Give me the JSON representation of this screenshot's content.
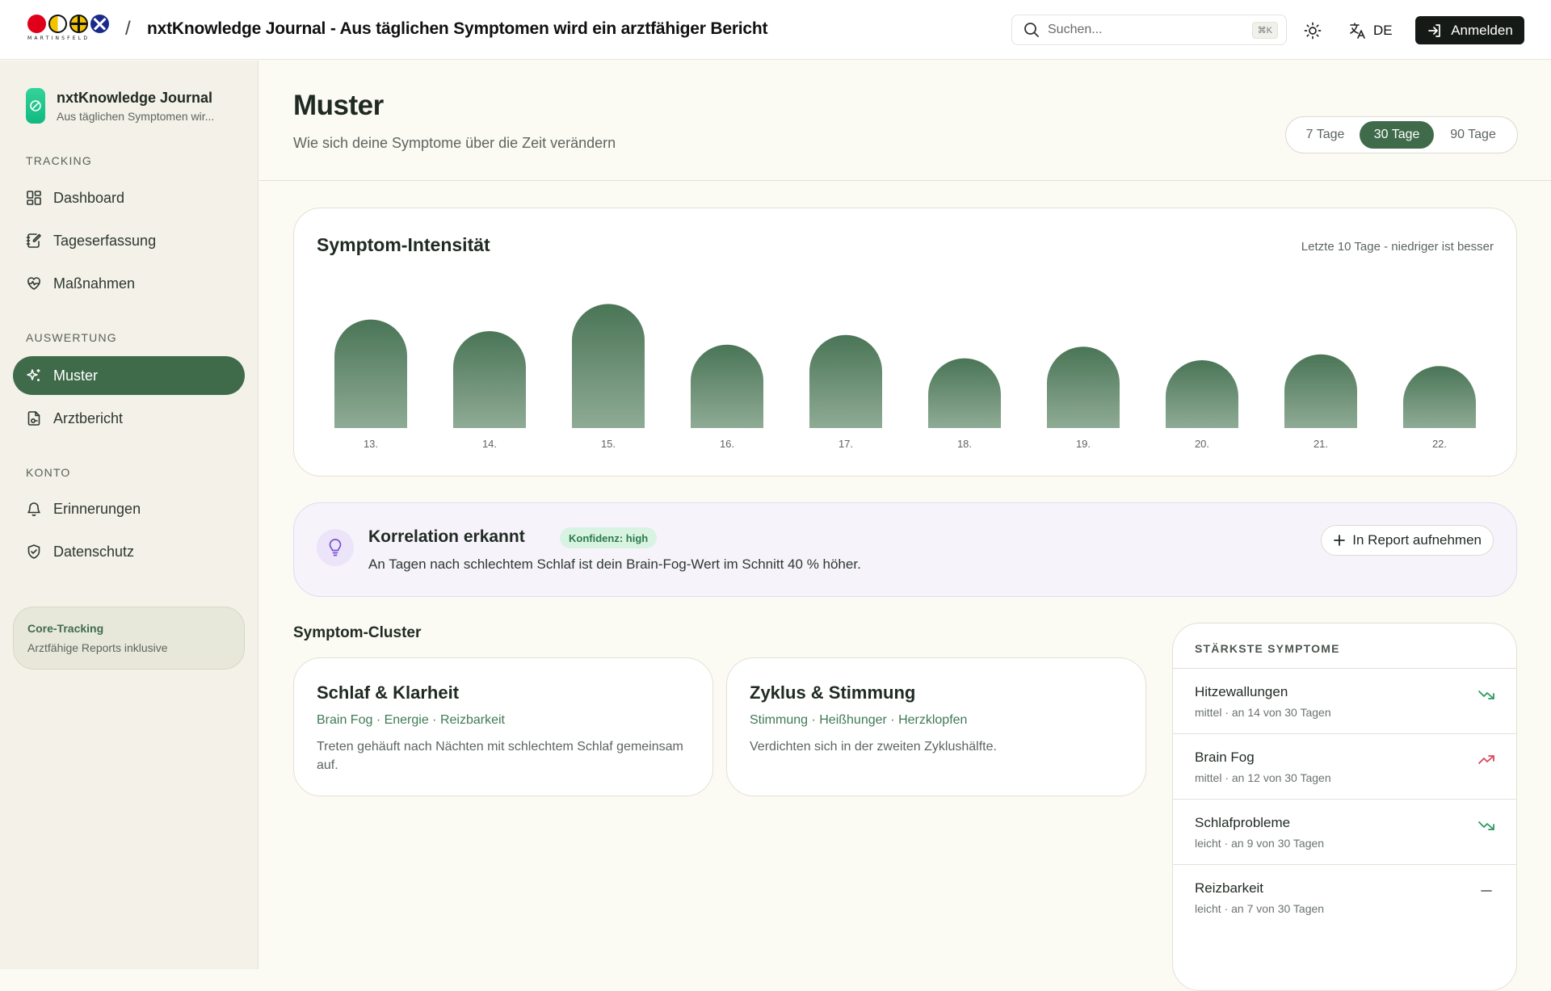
{
  "header": {
    "logo_wordmark": "MARTINSFELD",
    "separator": "/",
    "title": "nxtKnowledge Journal - Aus täglichen Symptomen wird ein arztfähiger Bericht",
    "search_placeholder": "Suchen...",
    "search_shortcut": "⌘K",
    "language": "DE",
    "login_label": "Anmelden"
  },
  "sidebar": {
    "brand_name": "nxtKnowledge Journal",
    "brand_sub": "Aus täglichen Symptomen wir...",
    "sections": [
      {
        "title": "TRACKING",
        "items": [
          "Dashboard",
          "Tageserfassung",
          "Maßnahmen"
        ]
      },
      {
        "title": "AUSWERTUNG",
        "items": [
          "Muster",
          "Arztbericht"
        ]
      },
      {
        "title": "KONTO",
        "items": [
          "Erinnerungen",
          "Datenschutz"
        ]
      }
    ],
    "active_item": "Muster",
    "plan_title": "Core-Tracking",
    "plan_sub": "Arztfähige Reports inklusive"
  },
  "page": {
    "title": "Muster",
    "subtitle": "Wie sich deine Symptome über die Zeit verändern",
    "ranges": [
      "7 Tage",
      "30 Tage",
      "90 Tage"
    ],
    "selected_range": "30 Tage"
  },
  "chart_card": {
    "title": "Symptom-Intensität",
    "note": "Letzte 10 Tage - niedriger ist besser"
  },
  "chart_data": {
    "type": "bar",
    "title": "Symptom-Intensität",
    "categories": [
      "13.",
      "14.",
      "15.",
      "16.",
      "17.",
      "18.",
      "19.",
      "20.",
      "21.",
      "22."
    ],
    "values": [
      5.6,
      5.0,
      6.4,
      4.3,
      4.8,
      3.6,
      4.2,
      3.5,
      3.8,
      3.2
    ],
    "ylim": [
      0,
      10
    ],
    "grid": false,
    "color": "#4f7a5b"
  },
  "correlation": {
    "title": "Korrelation erkannt",
    "badge": "Konfidenz: high",
    "text": "An Tagen nach schlechtem Schlaf ist dein Brain-Fog-Wert im Schnitt 40 % höher.",
    "button_label": "In Report aufnehmen"
  },
  "clusters": {
    "heading": "Symptom-Cluster",
    "items": [
      {
        "title": "Schlaf & Klarheit",
        "tags": "Brain Fog · Energie · Reizbarkeit",
        "desc": "Treten gehäuft nach Nächten mit schlechtem Schlaf gemeinsam auf."
      },
      {
        "title": "Zyklus & Stimmung",
        "tags": "Stimmung · Heißhunger · Herzklopfen",
        "desc": "Verdichten sich in der zweiten Zyklushälfte."
      }
    ]
  },
  "top_symptoms": {
    "heading": "STÄRKSTE SYMPTOME",
    "items": [
      {
        "name": "Hitzewallungen",
        "meta": "mittel · an 14 von 30 Tagen",
        "trend": "down",
        "trend_color": "#2e9a5e"
      },
      {
        "name": "Brain Fog",
        "meta": "mittel · an 12 von 30 Tagen",
        "trend": "up",
        "trend_color": "#d9465f"
      },
      {
        "name": "Schlafprobleme",
        "meta": "leicht · an 9 von 30 Tagen",
        "trend": "down",
        "trend_color": "#2e9a5e"
      },
      {
        "name": "Reizbarkeit",
        "meta": "leicht · an 7 von 30 Tagen",
        "trend": "flat",
        "trend_color": "#6b736d"
      }
    ]
  },
  "colors": {
    "accent": "#3f6b4b",
    "page_bg": "#fbfaf3",
    "sidebar_bg": "#f3f1e8"
  }
}
